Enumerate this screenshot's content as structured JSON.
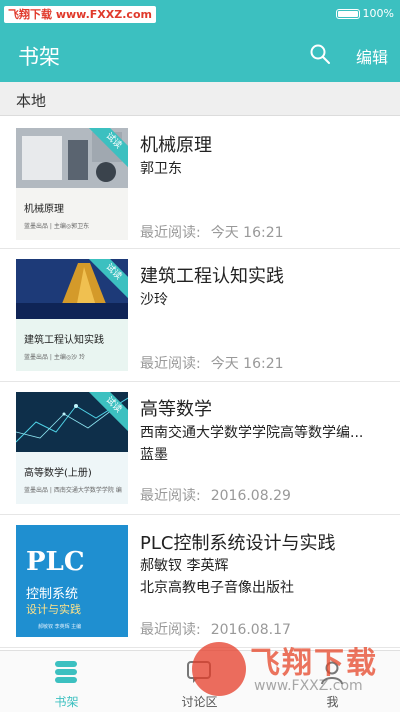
{
  "status_bar": {
    "watermark": "飞翔下载 www.FXXZ.com",
    "battery": "100%"
  },
  "app_bar": {
    "title": "书架",
    "search_icon": "search-icon",
    "edit_label": "编辑"
  },
  "section": {
    "label": "本地"
  },
  "books": [
    {
      "title": "机械原理",
      "lines": [
        "郭卫东"
      ],
      "last_read_label": "最近阅读:",
      "last_read_time": "今天 16:21",
      "trial_badge": "试读",
      "cover": {
        "title": "机械原理",
        "publisher": "蓝墨出品 | 主编◎郭卫东"
      }
    },
    {
      "title": "建筑工程认知实践",
      "lines": [
        "沙玲"
      ],
      "last_read_label": "最近阅读:",
      "last_read_time": "今天 16:21",
      "trial_badge": "试读",
      "cover": {
        "title": "建筑工程认知实践",
        "publisher": "蓝墨出品 | 主编◎沙 玲"
      }
    },
    {
      "title": "高等数学",
      "lines": [
        "西南交通大学数学学院高等数学编...",
        "蓝墨"
      ],
      "last_read_label": "最近阅读:",
      "last_read_time": "2016.08.29",
      "trial_badge": "试读",
      "cover": {
        "title": "高等数学(上册)",
        "publisher": "蓝墨出品 | 西南交通大学数学学院 编"
      }
    },
    {
      "title": "PLC控制系统设计与实践",
      "lines": [
        "郝敏钗  李英辉",
        "北京高教电子音像出版社"
      ],
      "last_read_label": "最近阅读:",
      "last_read_time": "2016.08.17",
      "cover": {
        "big": "PLC",
        "line1": "控制系统",
        "line2": "设计与实践",
        "footer": "郝敏钗 李英辉 主编"
      }
    }
  ],
  "bottom_nav": [
    {
      "label": "书架",
      "icon": "bookshelf-icon",
      "active": true
    },
    {
      "label": "讨论区",
      "icon": "discussion-icon",
      "active": false
    },
    {
      "label": "我",
      "icon": "profile-icon",
      "active": false
    }
  ],
  "watermark_logo": {
    "main": "飞翔下载",
    "url": "www.FXXZ.com"
  },
  "colors": {
    "accent": "#3cc0c0",
    "watermark_red": "#e0392b"
  }
}
